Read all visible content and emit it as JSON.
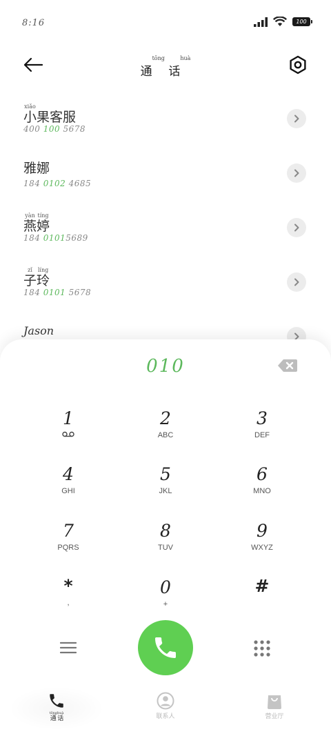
{
  "status_bar": {
    "time": "8:16",
    "battery": "100"
  },
  "header": {
    "back_icon": "arrow-left-icon",
    "title": "通话",
    "title_chars": [
      {
        "char": "通",
        "pinyin": "tōng"
      },
      {
        "char": "话",
        "pinyin": "huà"
      }
    ],
    "settings_icon": "hexagon-settings-icon"
  },
  "contacts": [
    {
      "name_chars": [
        {
          "char": "小",
          "pinyin": "xiǎo"
        },
        {
          "char": "果",
          "pinyin": ""
        },
        {
          "char": "客",
          "pinyin": ""
        },
        {
          "char": "服",
          "pinyin": ""
        }
      ],
      "number_parts": [
        {
          "text": "400 ",
          "highlight": false
        },
        {
          "text": "100",
          "highlight": true
        },
        {
          "text": " 5678",
          "highlight": false
        }
      ]
    },
    {
      "name_chars": [
        {
          "char": "雅",
          "pinyin": ""
        },
        {
          "char": "娜",
          "pinyin": ""
        }
      ],
      "number_parts": [
        {
          "text": "184 ",
          "highlight": false
        },
        {
          "text": "0102",
          "highlight": true
        },
        {
          "text": " 4685",
          "highlight": false
        }
      ]
    },
    {
      "name_chars": [
        {
          "char": "燕",
          "pinyin": "yàn"
        },
        {
          "char": "婷",
          "pinyin": "tíng"
        }
      ],
      "number_parts": [
        {
          "text": "184 ",
          "highlight": false
        },
        {
          "text": "0101",
          "highlight": true
        },
        {
          "text": "5689",
          "highlight": false
        }
      ]
    },
    {
      "name_chars": [
        {
          "char": "子",
          "pinyin": "zǐ"
        },
        {
          "char": "玲",
          "pinyin": "líng"
        }
      ],
      "number_parts": [
        {
          "text": "184 ",
          "highlight": false
        },
        {
          "text": "0101",
          "highlight": true
        },
        {
          "text": " 5678",
          "highlight": false
        }
      ]
    },
    {
      "name_text": "Jason",
      "number_parts": []
    }
  ],
  "dialer": {
    "dialed_number": "010",
    "keys": [
      {
        "digit": "1",
        "letters": "voicemail"
      },
      {
        "digit": "2",
        "letters": "ABC"
      },
      {
        "digit": "3",
        "letters": "DEF"
      },
      {
        "digit": "4",
        "letters": "GHI"
      },
      {
        "digit": "5",
        "letters": "JKL"
      },
      {
        "digit": "6",
        "letters": "MNO"
      },
      {
        "digit": "7",
        "letters": "PQRS"
      },
      {
        "digit": "8",
        "letters": "TUV"
      },
      {
        "digit": "9",
        "letters": "WXYZ"
      },
      {
        "digit": "*",
        "letters": ","
      },
      {
        "digit": "0",
        "letters": "+"
      },
      {
        "digit": "#",
        "letters": ""
      }
    ]
  },
  "bottom_nav": [
    {
      "name": "calls",
      "icon": "phone-icon",
      "chars": [
        {
          "char": "通",
          "pinyin": "tōng"
        },
        {
          "char": "话",
          "pinyin": "huà"
        }
      ],
      "active": true
    },
    {
      "name": "contacts",
      "icon": "person-icon",
      "chars": [
        {
          "char": "联",
          "pinyin": ""
        },
        {
          "char": "系",
          "pinyin": ""
        },
        {
          "char": "人",
          "pinyin": ""
        }
      ],
      "active": false
    },
    {
      "name": "shop",
      "icon": "shopping-bag-icon",
      "chars": [
        {
          "char": "营",
          "pinyin": ""
        },
        {
          "char": "业",
          "pinyin": ""
        },
        {
          "char": "厅",
          "pinyin": ""
        }
      ],
      "active": false
    }
  ],
  "colors": {
    "accent_green": "#5cb85c",
    "call_button": "#5fcf52"
  }
}
